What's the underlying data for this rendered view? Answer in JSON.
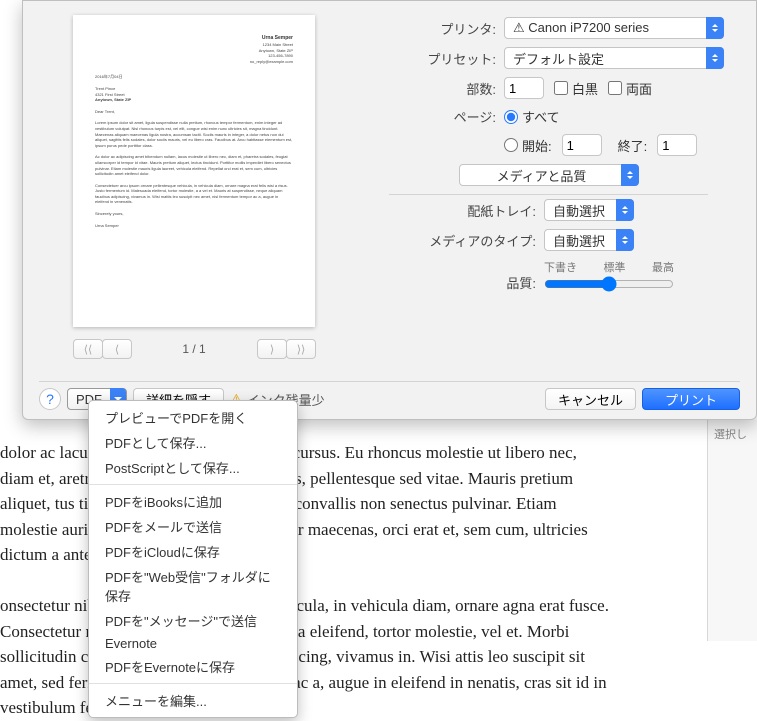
{
  "labels": {
    "printer": "プリンタ:",
    "preset": "プリセット:",
    "copies": "部数:",
    "pages": "ページ:",
    "all": "すべて",
    "from": "開始:",
    "to": "終了:",
    "bw": "白黒",
    "duplex": "両面",
    "paperTray": "配紙トレイ:",
    "mediaType": "メディアのタイプ:",
    "quality": "品質:",
    "q1": "下書き",
    "q2": "標準",
    "q3": "最高"
  },
  "values": {
    "printer": "⚠ Canon iP7200 series",
    "preset": "デフォルト設定",
    "copies": "1",
    "from": "1",
    "to": "1",
    "section": "メディアと品質",
    "paperTray": "自動選択",
    "mediaType": "自動選択"
  },
  "pager": {
    "indicator": "1 / 1"
  },
  "bottom": {
    "help": "?",
    "pdf": "PDF",
    "details": "詳細を隠す",
    "ink": "インク残量少",
    "cancel": "キャンセル",
    "print": "プリント"
  },
  "menu": [
    "プレビューでPDFを開く",
    "PDFとして保存...",
    "PostScriptとして保存...",
    "-",
    "PDFをiBooksに追加",
    "PDFをメールで送信",
    "PDFをiCloudに保存",
    "PDFを\"Web受信\"フォルダに保存",
    "PDFを\"メッセージ\"で送信",
    "Evernote",
    "PDFをEvernoteに保存",
    "-",
    "メニューを編集..."
  ],
  "side": "選択し",
  "bg": " dolor ac lacus rhoncus, eu consectetur erat cursus. Eu rhoncus molestie ut libero nec, diam et, aretra sodales. Diam nisi ut facilisis, pellentesque sed vitae. Mauris pretium aliquet, tus tincidunt orci tincidunt. Magna convallis non senectus pulvinar. Etiam molestie auris ligula nunc vulputate pulvinar maecenas, orci erat et, sem cum, ultricies dictum a ante.",
  "bg2": "onsectetur nibh, venenatis sit porta, mi vehicula, in vehicula diam, ornare agna erat fusce. Consectetur nulla lobortis cursus. Malesuada eleifend, tortor molestie, vel et. Morbi sollicitudin congue vivamus faucibus adipiscing, vivamus in. Wisi attis leo suscipit sit amet, sed fermentum magna sodales tortor ac a, augue in eleifend in nenatis, cras sit id in vestibulum felis in, sed ligula.",
  "preview": {
    "sender": "Urna Semper",
    "addr1": "1234 Main Street",
    "addr2": "Anytown, State ZIP",
    "phone": "123-456-7890",
    "email": "no_reply@example.com",
    "date": "2016年7月04日",
    "to1": "Trent Pince",
    "to2": "4321 First Street",
    "to3": "Anytown, State ZIP",
    "greet": "Dear Trent,",
    "closing": "Sincerely yours,",
    "sig": "Urna Semper"
  }
}
